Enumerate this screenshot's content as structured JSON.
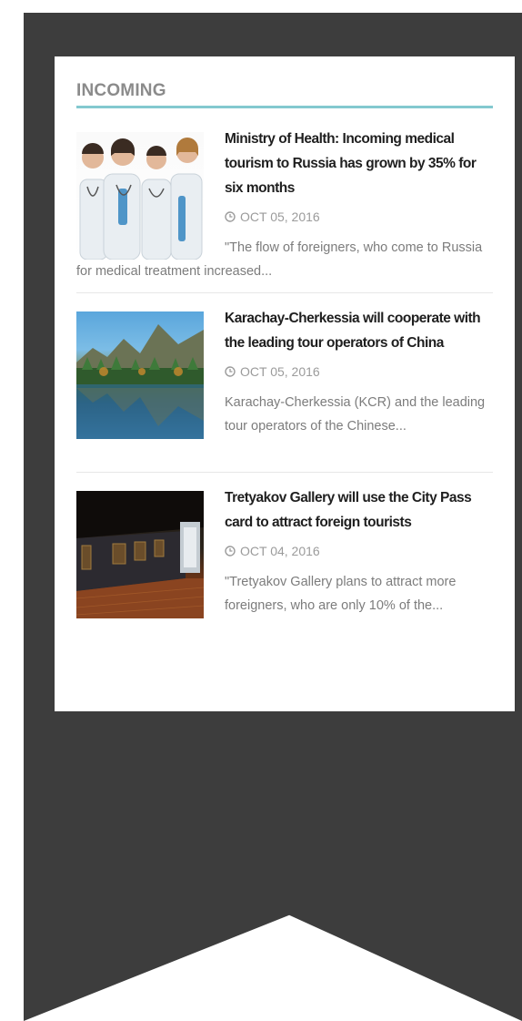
{
  "section": {
    "title": "INCOMING"
  },
  "articles": [
    {
      "headline": "Ministry of Health: Incoming medical tourism to Russia has grown by 35% for six months",
      "date": "OCT 05, 2016",
      "excerpt": "\"The flow of foreigners, who come to Russia for medical treatment increased...",
      "thumbnail": "doctors-group-photo"
    },
    {
      "headline": "Karachay-Cherkessia will cooperate with the leading tour operators of China",
      "date": "OCT 05, 2016",
      "excerpt": "Karachay-Cherkessia (KCR) and the leading tour operators of the Chinese...",
      "thumbnail": "mountain-lake-photo"
    },
    {
      "headline": "Tretyakov Gallery will use the City Pass card to attract foreign tourists",
      "date": "OCT 04, 2016",
      "excerpt": "\"Tretyakov Gallery plans to attract more foreigners, who are only 10% of the...",
      "thumbnail": "gallery-hall-photo"
    }
  ],
  "colors": {
    "ribbon": "#3d3d3d",
    "title_underline": "#83c9cf",
    "headline": "#1f1f1f",
    "meta": "#9b9b9b"
  },
  "icons": {
    "date": "clock-icon"
  }
}
